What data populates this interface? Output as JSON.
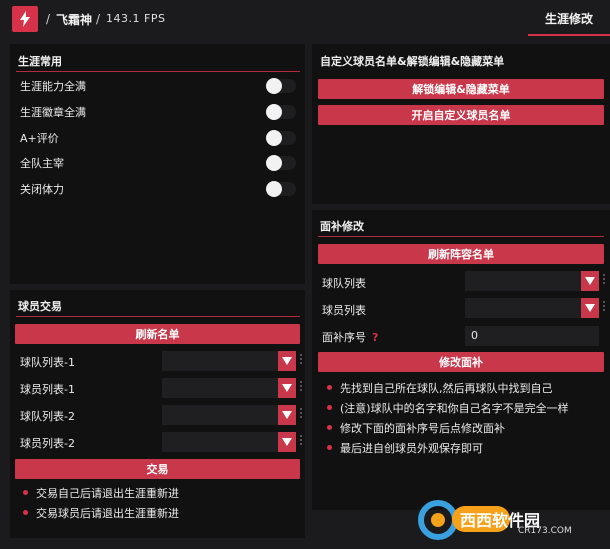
{
  "header": {
    "app_title": "飞霜神",
    "fps": "143.1 FPS",
    "tab_label": "生涯修改"
  },
  "career_common": {
    "title": "生涯常用",
    "items": [
      {
        "label": "生涯能力全满",
        "on": false
      },
      {
        "label": "生涯徽章全满",
        "on": false
      },
      {
        "label": "A+评价",
        "on": false
      },
      {
        "label": "全队主宰",
        "on": false
      },
      {
        "label": "关闭体力",
        "on": false
      }
    ]
  },
  "custom_roster": {
    "title": "自定义球员名单&解锁编辑&隐藏菜单",
    "unlock_button": "解锁编辑&隐藏菜单",
    "enable_button": "开启自定义球员名单"
  },
  "player_trade": {
    "title": "球员交易",
    "refresh_button": "刷新名单",
    "rows": [
      {
        "label": "球队列表-1",
        "value": ""
      },
      {
        "label": "球员列表-1",
        "value": ""
      },
      {
        "label": "球队列表-2",
        "value": ""
      },
      {
        "label": "球员列表-2",
        "value": ""
      }
    ],
    "trade_button": "交易",
    "notes": [
      "交易自己后请退出生涯重新进",
      "交易球员后请退出生涯重新进"
    ]
  },
  "face_edit": {
    "title": "面补修改",
    "refresh_button": "刷新阵容名单",
    "team_label": "球队列表",
    "player_label": "球员列表",
    "face_id_label": "面补序号",
    "face_id_help": "?",
    "face_id_value": "0",
    "apply_button": "修改面补",
    "notes": [
      "先找到自己所在球队,然后再球队中找到自己",
      "(注意)球队中的名字和你自己名字不是完全一样",
      "修改下面的面补序号后点修改面补",
      "最后进自创球员外观保存即可"
    ]
  },
  "watermark": {
    "main": "西西软件园",
    "sub": "CR173.COM"
  },
  "colors": {
    "accent": "#c8374a",
    "background": "#1b1b1d",
    "panel": "#111112"
  }
}
